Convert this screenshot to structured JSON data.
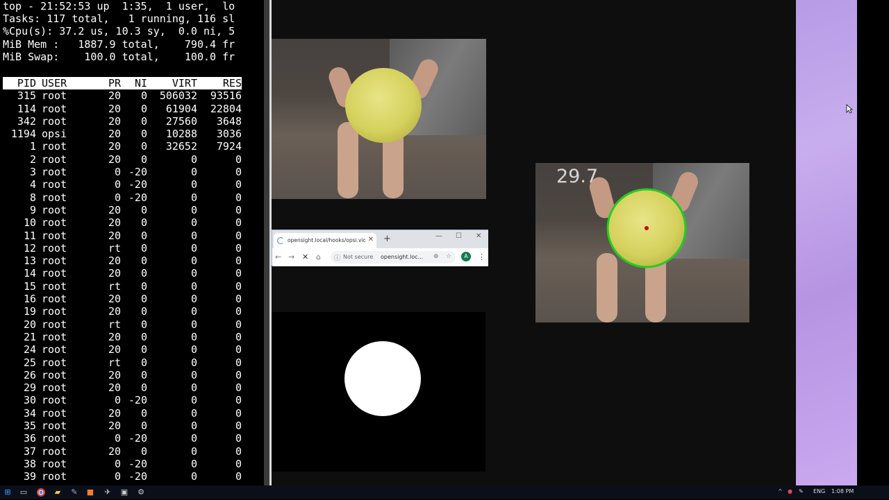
{
  "terminal": {
    "header_lines": [
      "top - 21:52:53 up  1:35,  1 user,  lo",
      "Tasks: 117 total,   1 running, 116 sl",
      "%Cpu(s): 37.2 us, 10.3 sy,  0.0 ni, 5",
      "MiB Mem :   1887.9 total,    790.4 fr",
      "MiB Swap:    100.0 total,    100.0 fr"
    ],
    "columns": [
      "PID",
      "USER",
      "PR",
      "NI",
      "VIRT",
      "RES"
    ],
    "rows": [
      [
        "315",
        "root",
        "20",
        "0",
        "506032",
        "93516"
      ],
      [
        "114",
        "root",
        "20",
        "0",
        "61904",
        "22804"
      ],
      [
        "342",
        "root",
        "20",
        "0",
        "27560",
        "3648"
      ],
      [
        "1194",
        "opsi",
        "20",
        "0",
        "10288",
        "3036"
      ],
      [
        "1",
        "root",
        "20",
        "0",
        "32652",
        "7924"
      ],
      [
        "2",
        "root",
        "20",
        "0",
        "0",
        "0"
      ],
      [
        "3",
        "root",
        "0",
        "-20",
        "0",
        "0"
      ],
      [
        "4",
        "root",
        "0",
        "-20",
        "0",
        "0"
      ],
      [
        "8",
        "root",
        "0",
        "-20",
        "0",
        "0"
      ],
      [
        "9",
        "root",
        "20",
        "0",
        "0",
        "0"
      ],
      [
        "10",
        "root",
        "20",
        "0",
        "0",
        "0"
      ],
      [
        "11",
        "root",
        "20",
        "0",
        "0",
        "0"
      ],
      [
        "12",
        "root",
        "rt",
        "0",
        "0",
        "0"
      ],
      [
        "13",
        "root",
        "20",
        "0",
        "0",
        "0"
      ],
      [
        "14",
        "root",
        "20",
        "0",
        "0",
        "0"
      ],
      [
        "15",
        "root",
        "rt",
        "0",
        "0",
        "0"
      ],
      [
        "16",
        "root",
        "20",
        "0",
        "0",
        "0"
      ],
      [
        "19",
        "root",
        "20",
        "0",
        "0",
        "0"
      ],
      [
        "20",
        "root",
        "rt",
        "0",
        "0",
        "0"
      ],
      [
        "21",
        "root",
        "20",
        "0",
        "0",
        "0"
      ],
      [
        "24",
        "root",
        "20",
        "0",
        "0",
        "0"
      ],
      [
        "25",
        "root",
        "rt",
        "0",
        "0",
        "0"
      ],
      [
        "26",
        "root",
        "20",
        "0",
        "0",
        "0"
      ],
      [
        "29",
        "root",
        "20",
        "0",
        "0",
        "0"
      ],
      [
        "30",
        "root",
        "0",
        "-20",
        "0",
        "0"
      ],
      [
        "34",
        "root",
        "20",
        "0",
        "0",
        "0"
      ],
      [
        "35",
        "root",
        "20",
        "0",
        "0",
        "0"
      ],
      [
        "36",
        "root",
        "0",
        "-20",
        "0",
        "0"
      ],
      [
        "37",
        "root",
        "20",
        "0",
        "0",
        "0"
      ],
      [
        "38",
        "root",
        "0",
        "-20",
        "0",
        "0"
      ],
      [
        "39",
        "root",
        "0",
        "-20",
        "0",
        "0"
      ]
    ]
  },
  "browser": {
    "tab_title": "opensight.local/hooks/opsi.vide",
    "new_tab": "+",
    "security": "Not secure",
    "url": "opensight.loc...",
    "avatar_letter": "A"
  },
  "processed_view": {
    "fps": "29.7",
    "circle_color": "#22cc22",
    "center_color": "#cc0000"
  },
  "taskbar": {
    "language": "ENG",
    "time": "1:08 PM"
  },
  "icons": [
    "start-icon",
    "task-view-icon",
    "chrome-icon",
    "file-explorer-icon",
    "pen-icon",
    "app-icon",
    "terminal-icon",
    "photos-icon",
    "settings-icon",
    "mouse-cursor-icon"
  ]
}
